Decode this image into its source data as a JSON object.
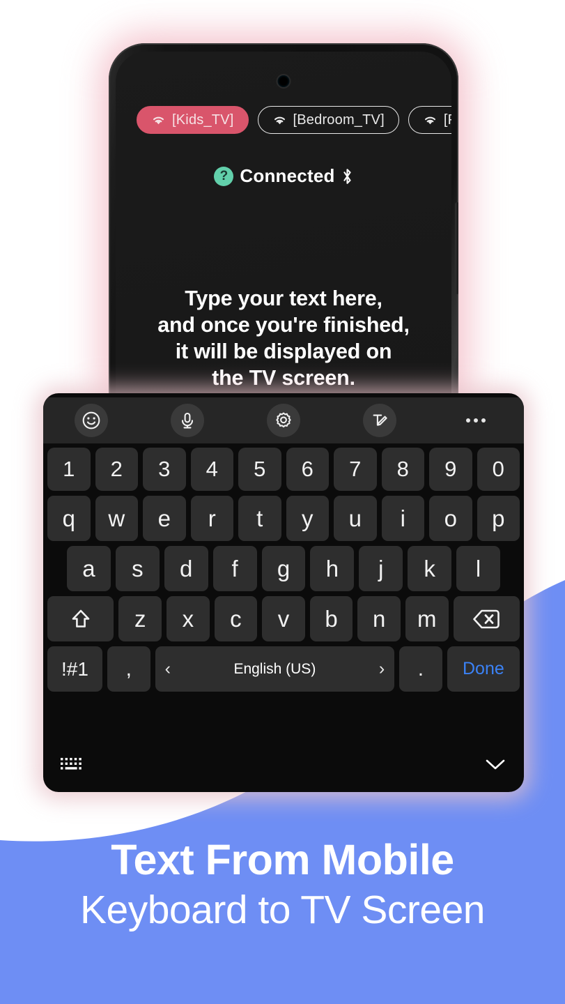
{
  "theme": {
    "blue": "#6e8ef4",
    "chip_active": "#d9556b",
    "badge_green": "#62d0ab",
    "done_blue": "#3b82f6",
    "page_background": "#ffffff"
  },
  "phone": {
    "devices": [
      {
        "label": "[Kids_TV]",
        "icon": "wifi-icon",
        "active": true
      },
      {
        "label": "[Bedroom_TV]",
        "icon": "wifi-icon",
        "active": false
      },
      {
        "label": "[Pa",
        "icon": "wifi-icon",
        "active": false
      }
    ],
    "status": {
      "help_badge": "?",
      "label": "Connected",
      "bluetooth_icon": "bluetooth-icon"
    },
    "hint_lines": [
      "Type your text here,",
      "and once you're finished,",
      "it will be displayed on",
      "the TV screen."
    ]
  },
  "keyboard": {
    "toolbar": [
      {
        "name": "emoji-icon",
        "label": "emoji"
      },
      {
        "name": "microphone-icon",
        "label": "voice input"
      },
      {
        "name": "gear-icon",
        "label": "settings"
      },
      {
        "name": "handwriting-icon",
        "label": "handwriting"
      },
      {
        "name": "more-options-icon",
        "label": "more options"
      }
    ],
    "rows": {
      "numbers": [
        "1",
        "2",
        "3",
        "4",
        "5",
        "6",
        "7",
        "8",
        "9",
        "0"
      ],
      "top": [
        "q",
        "w",
        "e",
        "r",
        "t",
        "y",
        "u",
        "i",
        "o",
        "p"
      ],
      "home": [
        "a",
        "s",
        "d",
        "f",
        "g",
        "h",
        "j",
        "k",
        "l"
      ],
      "bottom": [
        "z",
        "x",
        "c",
        "v",
        "b",
        "n",
        "m"
      ]
    },
    "shift_key": "shift-icon",
    "backspace_key": "backspace-icon",
    "symbols_key": "!#1",
    "comma_key": ",",
    "period_key": ".",
    "space_key": {
      "language": "English (US)",
      "prev": "‹",
      "next": "›"
    },
    "done_key": "Done",
    "bottom_bar": {
      "layout_icon": "keyboard-layout-icon",
      "hide_icon": "chevron-down-icon"
    }
  },
  "footer": {
    "line1": "Text From Mobile",
    "line2": "Keyboard to TV Screen"
  }
}
